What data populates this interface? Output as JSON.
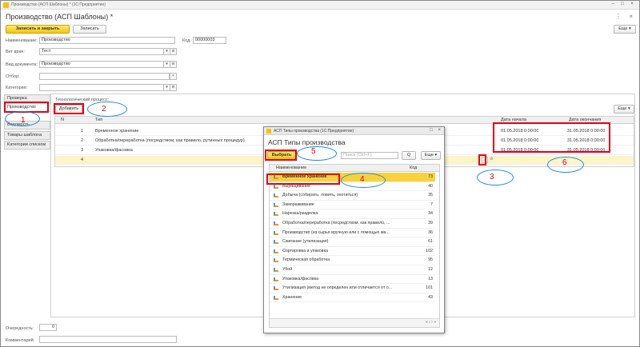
{
  "titlebar": {
    "title": "Производство (АСП Шаблоны) * (1С:Предприятие)"
  },
  "form": {
    "title": "Производство (АСП Шаблоны) *",
    "save_close": "Записать и закрыть",
    "save": "Записать",
    "more": "Еще",
    "name_label": "Наименование:",
    "name_value": "Производство",
    "code_label": "Код:",
    "code_value": "00000003",
    "vet_label": "Вет врач:",
    "vet_value": "Тест",
    "doctype_label": "Вид документа:",
    "doctype_value": "Производство",
    "filter_label": "Отбор:",
    "filter_value": "",
    "category_label": "Категория:",
    "category_value": ""
  },
  "tabs": [
    "Проверка",
    "Производство",
    "Ведомость",
    "Товары шаблона",
    "Категории списком"
  ],
  "process": {
    "label": "Технологический процесс:",
    "add": "Добавить",
    "more": "Еще",
    "columns": {
      "n": "N",
      "type": "Тип",
      "start": "Дата начала",
      "end": "Дата окончания"
    },
    "rows": [
      {
        "n": "1",
        "type": "Временное хранение",
        "start": "01.05.2018 0:00:00",
        "end": "31.05.2018 0:00:00"
      },
      {
        "n": "2",
        "type": "Обработка/переработка (посредством, как правило, рутинных процедур)",
        "start": "01.05.2018 0:00:00",
        "end": "31.05.2018 0:00:00"
      },
      {
        "n": "3",
        "type": "Упаковка/фасовка",
        "start": "01.05.2018 0:00:00",
        "end": "31.05.2018 0:00:00"
      },
      {
        "n": "4",
        "type": "",
        "start": "",
        "end": ""
      }
    ],
    "dots": "...",
    "link_icon": "link-icon"
  },
  "footer": {
    "count_label": "Очередность:",
    "count_value": "0",
    "comment_label": "Комментарий:"
  },
  "dialog": {
    "window_title": "АСП Типы производства (1С:Предприятие)",
    "title": "АСП Типы производства",
    "select": "Выбрать",
    "search_placeholder": "Поиск (Ctrl+F)",
    "search_btn": "Q",
    "more": "Еще",
    "col_name": "Наименование",
    "col_code": "Код",
    "items": [
      {
        "name": "Временное хранение",
        "code": "73"
      },
      {
        "name": "Выращивание",
        "code": "40"
      },
      {
        "name": "Добыча (собирать, ловить, охотиться)",
        "code": "35"
      },
      {
        "name": "Замораживание",
        "code": "7"
      },
      {
        "name": "Нарезка/разделка",
        "code": "34"
      },
      {
        "name": "Обработка/переработка (посредством, как правило, ...",
        "code": "39"
      },
      {
        "name": "Производство (из сырья вручную или с помощью ма...",
        "code": "36"
      },
      {
        "name": "Сжигание (утилизация)",
        "code": "61"
      },
      {
        "name": "Сортировка и упаковка",
        "code": "102"
      },
      {
        "name": "Термическая обработка",
        "code": "95"
      },
      {
        "name": "Убой",
        "code": "12"
      },
      {
        "name": "Упаковка/фасовка",
        "code": "13"
      },
      {
        "name": "Утилизация (метод не определен или отличается от о...",
        "code": "101"
      },
      {
        "name": "Хранение",
        "code": "43"
      }
    ]
  },
  "annotations": [
    "1",
    "2",
    "3",
    "4",
    "5",
    "6"
  ],
  "colors": {
    "accent": "#f5c800",
    "highlight": "#e3001b",
    "circle": "#1e8bd8"
  }
}
